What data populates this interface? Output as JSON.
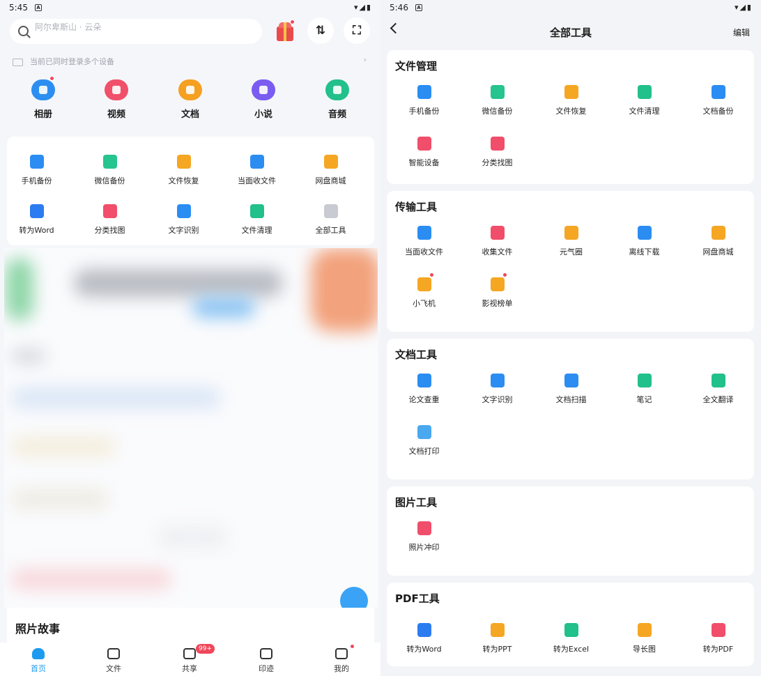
{
  "left": {
    "status": {
      "time": "5:45",
      "notif": "A",
      "icons": "▾◢▮"
    },
    "search": {
      "placeholder": "阿尔卑斯山 · 云朵"
    },
    "devices_notice": "当前已同时登录多个设备",
    "categories": [
      {
        "label": "相册",
        "color": "#2c8ef0",
        "dot": true
      },
      {
        "label": "视频",
        "color": "#f0506a",
        "dot": false
      },
      {
        "label": "文档",
        "color": "#f5a020",
        "dot": false
      },
      {
        "label": "小说",
        "color": "#7a5cf0",
        "dot": false
      },
      {
        "label": "音频",
        "color": "#22c08a",
        "dot": false
      }
    ],
    "tools": [
      {
        "label": "手机备份",
        "color": "#2b8df2"
      },
      {
        "label": "微信备份",
        "color": "#26c48e"
      },
      {
        "label": "文件恢复",
        "color": "#f5a623"
      },
      {
        "label": "当面收文件",
        "color": "#2b8df2"
      },
      {
        "label": "网盘商城",
        "color": "#f5a623"
      },
      {
        "label": "转为Word",
        "color": "#2b7cf0"
      },
      {
        "label": "分类找图",
        "color": "#f04e6a"
      },
      {
        "label": "文字识别",
        "color": "#2b8df2"
      },
      {
        "label": "文件清理",
        "color": "#22c08a"
      },
      {
        "label": "全部工具",
        "color": "#c8cbd2"
      }
    ],
    "photo_story": "照片故事",
    "tabs": [
      {
        "label": "首页",
        "active": true
      },
      {
        "label": "文件",
        "active": false
      },
      {
        "label": "共享",
        "active": false
      },
      {
        "label": "印迹",
        "active": false
      },
      {
        "label": "我的",
        "active": false
      }
    ],
    "share_badge": "99+"
  },
  "right": {
    "status": {
      "time": "5:46",
      "notif": "A",
      "icons": "▾◢▮"
    },
    "title": "全部工具",
    "edit": "编辑",
    "sections": [
      {
        "title": "文件管理",
        "items": [
          {
            "label": "手机备份",
            "color": "#2b8df2",
            "dot": false
          },
          {
            "label": "微信备份",
            "color": "#26c48e",
            "dot": false
          },
          {
            "label": "文件恢复",
            "color": "#f5a623",
            "dot": false
          },
          {
            "label": "文件清理",
            "color": "#22c08a",
            "dot": false
          },
          {
            "label": "文档备份",
            "color": "#2b8df2",
            "dot": false
          },
          {
            "label": "智能设备",
            "color": "#f04e6a",
            "dot": false
          },
          {
            "label": "分类找图",
            "color": "#f04e6a",
            "dot": false
          }
        ]
      },
      {
        "title": "传输工具",
        "items": [
          {
            "label": "当面收文件",
            "color": "#2b8df2",
            "dot": false
          },
          {
            "label": "收集文件",
            "color": "#f04e6a",
            "dot": false
          },
          {
            "label": "元气圈",
            "color": "#f5a623",
            "dot": false
          },
          {
            "label": "离线下载",
            "color": "#2b8df2",
            "dot": false
          },
          {
            "label": "网盘商城",
            "color": "#f5a623",
            "dot": false
          },
          {
            "label": "小飞机",
            "color": "#f5a623",
            "dot": true
          },
          {
            "label": "影视榜单",
            "color": "#f5a623",
            "dot": true
          }
        ]
      },
      {
        "title": "文档工具",
        "items": [
          {
            "label": "论文查重",
            "color": "#2b8df2",
            "dot": false
          },
          {
            "label": "文字识别",
            "color": "#2b8df2",
            "dot": false
          },
          {
            "label": "文档扫描",
            "color": "#2b8df2",
            "dot": false
          },
          {
            "label": "笔记",
            "color": "#22c08a",
            "dot": false
          },
          {
            "label": "全文翻译",
            "color": "#22c08a",
            "dot": false
          },
          {
            "label": "文档打印",
            "color": "#4aa8f0",
            "dot": false
          }
        ]
      },
      {
        "title": "图片工具",
        "items": [
          {
            "label": "照片冲印",
            "color": "#f04e6a",
            "dot": false
          }
        ]
      },
      {
        "title": "PDF工具",
        "items": [
          {
            "label": "转为Word",
            "color": "#2b7cf0",
            "dot": false
          },
          {
            "label": "转为PPT",
            "color": "#f5a623",
            "dot": false
          },
          {
            "label": "转为Excel",
            "color": "#22c08a",
            "dot": false
          },
          {
            "label": "导长图",
            "color": "#f5a623",
            "dot": false
          },
          {
            "label": "转为PDF",
            "color": "#f04e6a",
            "dot": false
          }
        ]
      }
    ]
  }
}
